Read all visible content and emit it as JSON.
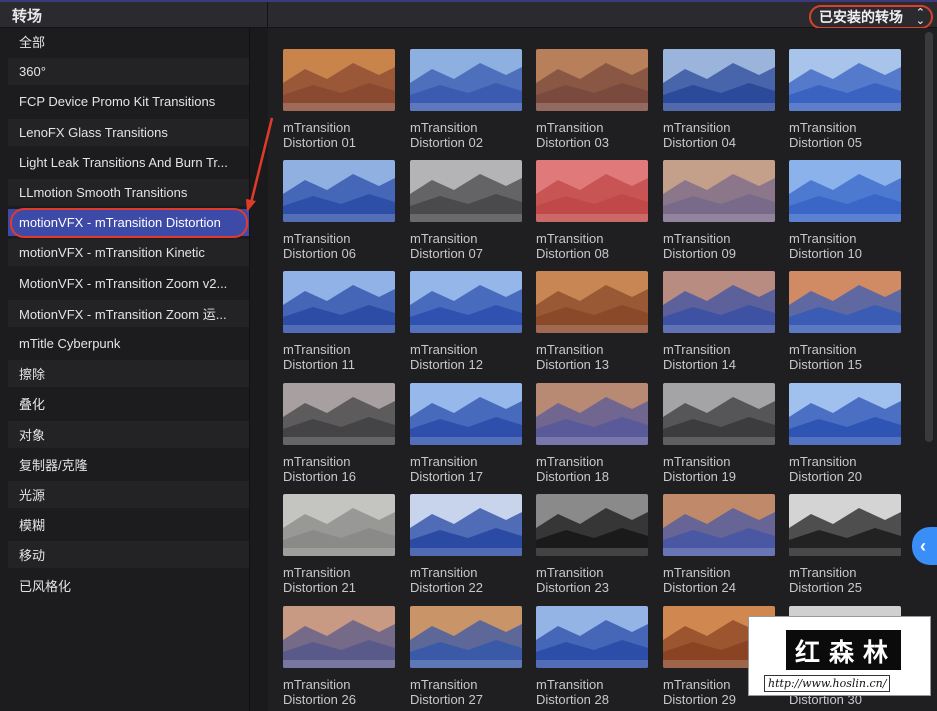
{
  "panel_title": "转场",
  "filter": {
    "label": "已安装的转场",
    "chevron": "⌃⌄"
  },
  "sidebar": {
    "items": [
      {
        "label": "全部"
      },
      {
        "label": "360°"
      },
      {
        "label": "FCP Device Promo Kit Transitions"
      },
      {
        "label": "LenoFX Glass Transitions"
      },
      {
        "label": "Light Leak Transitions And Burn Tr..."
      },
      {
        "label": "LLmotion Smooth Transitions"
      },
      {
        "label": "motionVFX - mTransition Distortion",
        "selected": true
      },
      {
        "label": "motionVFX - mTransition Kinetic"
      },
      {
        "label": "MotionVFX - mTransition Zoom v2..."
      },
      {
        "label": "MotionVFX - mTransition Zoom 运..."
      },
      {
        "label": "mTitle Cyberpunk"
      },
      {
        "label": "擦除"
      },
      {
        "label": "叠化"
      },
      {
        "label": "对象"
      },
      {
        "label": "复制器/克隆"
      },
      {
        "label": "光源"
      },
      {
        "label": "模糊"
      },
      {
        "label": "移动"
      },
      {
        "label": "已风格化"
      }
    ]
  },
  "grid": {
    "items": [
      {
        "line1": "mTransition",
        "line2": "Distortion 01",
        "c1": "#8a4a32",
        "c2": "#c9844c"
      },
      {
        "line1": "mTransition",
        "line2": "Distortion 02",
        "c1": "#3a5bb0",
        "c2": "#8db0e0"
      },
      {
        "line1": "mTransition",
        "line2": "Distortion 03",
        "c1": "#7a4a3e",
        "c2": "#b8805a"
      },
      {
        "line1": "mTransition",
        "line2": "Distortion 04",
        "c1": "#2c4a9a",
        "c2": "#9ab4dc"
      },
      {
        "line1": "mTransition",
        "line2": "Distortion 05",
        "c1": "#3a62c0",
        "c2": "#a8c4ea"
      },
      {
        "line1": "mTransition",
        "line2": "Distortion 06",
        "c1": "#2e4fa8",
        "c2": "#90b0e2"
      },
      {
        "line1": "mTransition",
        "line2": "Distortion 07",
        "c1": "#4a4a4c",
        "c2": "#b4b4b6"
      },
      {
        "line1": "mTransition",
        "line2": "Distortion 08",
        "c1": "#c04848",
        "c2": "#e07a7a"
      },
      {
        "line1": "mTransition",
        "line2": "Distortion 09",
        "c1": "#7a6a8a",
        "c2": "#c4a08a"
      },
      {
        "line1": "mTransition",
        "line2": "Distortion 10",
        "c1": "#3a66c8",
        "c2": "#8cb2ec"
      },
      {
        "line1": "mTransition",
        "line2": "Distortion 11",
        "c1": "#2c4ca6",
        "c2": "#90b2e6"
      },
      {
        "line1": "mTransition",
        "line2": "Distortion 12",
        "c1": "#2f52b0",
        "c2": "#94b6e8"
      },
      {
        "line1": "mTransition",
        "line2": "Distortion 13",
        "c1": "#8a4a2a",
        "c2": "#c88654"
      },
      {
        "line1": "mTransition",
        "line2": "Distortion 14",
        "c1": "#3e52a4",
        "c2": "#b88c80"
      },
      {
        "line1": "mTransition",
        "line2": "Distortion 15",
        "c1": "#3a5cb4",
        "c2": "#d08a64"
      },
      {
        "line1": "mTransition",
        "line2": "Distortion 16",
        "c1": "#444446",
        "c2": "#a8a0a0"
      },
      {
        "line1": "mTransition",
        "line2": "Distortion 17",
        "c1": "#2e50ac",
        "c2": "#96b8ea"
      },
      {
        "line1": "mTransition",
        "line2": "Distortion 18",
        "c1": "#5a5a9a",
        "c2": "#b88a74"
      },
      {
        "line1": "mTransition",
        "line2": "Distortion 19",
        "c1": "#3c3c3e",
        "c2": "#a4a4a6"
      },
      {
        "line1": "mTransition",
        "line2": "Distortion 20",
        "c1": "#2e54b4",
        "c2": "#a0c0ee"
      },
      {
        "line1": "mTransition",
        "line2": "Distortion 21",
        "c1": "#8a8a88",
        "c2": "#c4c4c0"
      },
      {
        "line1": "mTransition",
        "line2": "Distortion 22",
        "c1": "#2a4aa4",
        "c2": "#c8d4ec"
      },
      {
        "line1": "mTransition",
        "line2": "Distortion 23",
        "c1": "#1a1a1a",
        "c2": "#8a8a8a"
      },
      {
        "line1": "mTransition",
        "line2": "Distortion 24",
        "c1": "#4a58a4",
        "c2": "#c08a6a"
      },
      {
        "line1": "mTransition",
        "line2": "Distortion 25",
        "c1": "#222222",
        "c2": "#d4d4d4"
      },
      {
        "line1": "mTransition",
        "line2": "Distortion 26",
        "c1": "#5a5a8a",
        "c2": "#c89a84"
      },
      {
        "line1": "mTransition",
        "line2": "Distortion 27",
        "c1": "#3a5aa8",
        "c2": "#c89468"
      },
      {
        "line1": "mTransition",
        "line2": "Distortion 28",
        "c1": "#2c4ea8",
        "c2": "#94b4e6"
      },
      {
        "line1": "mTransition",
        "line2": "Distortion 29",
        "c1": "#8a4424",
        "c2": "#d08850"
      },
      {
        "line1": "mTransition",
        "line2": "Distortion 30",
        "c1": "#3a3a3a",
        "c2": "#d0d0d0"
      }
    ]
  },
  "collapse_icon": "chevron-left-icon",
  "watermark": {
    "brand": "红森林",
    "url": "http://www.hoslin.cn/"
  }
}
